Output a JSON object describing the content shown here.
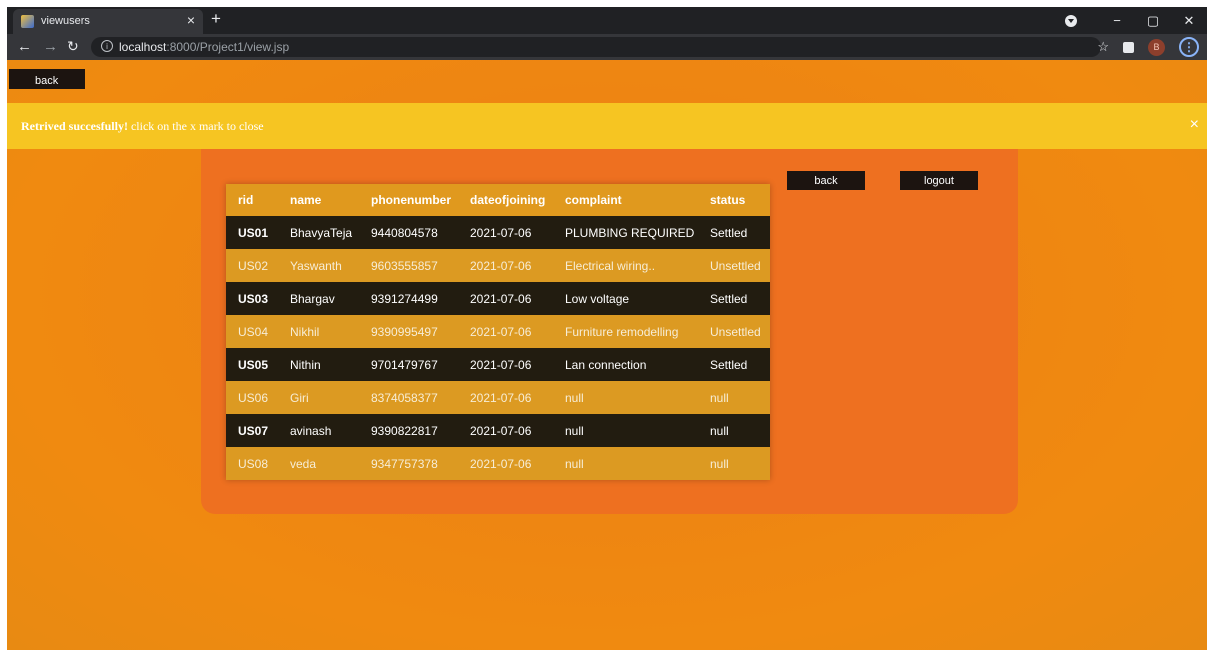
{
  "browser": {
    "tab_title": "viewusers",
    "tab_close": "×",
    "new_tab": "+",
    "url_host": "localhost",
    "url_rest": ":8000/Project1/view.jsp",
    "profile_initial": "B",
    "window_controls": [
      "−",
      "▢",
      "✕"
    ]
  },
  "page": {
    "top_back_label": "back",
    "alert": {
      "strong": "Retrived succesfully!",
      "text": " click on the x mark to close",
      "close": "×"
    },
    "back_label": "back",
    "logout_label": "logout"
  },
  "table": {
    "headers": [
      "rid",
      "name",
      "phonenumber",
      "dateofjoining",
      "complaint",
      "status"
    ],
    "rows": [
      {
        "rid": "US01",
        "name": "BhavyaTeja",
        "phone": "9440804578",
        "date": "2021-07-06",
        "complaint": "PLUMBING REQUIRED",
        "status": "Settled"
      },
      {
        "rid": "US02",
        "name": "Yaswanth",
        "phone": "9603555857",
        "date": "2021-07-06",
        "complaint": "Electrical wiring..",
        "status": "Unsettled"
      },
      {
        "rid": "US03",
        "name": "Bhargav",
        "phone": "9391274499",
        "date": "2021-07-06",
        "complaint": "Low voltage",
        "status": "Settled"
      },
      {
        "rid": "US04",
        "name": "Nikhil",
        "phone": "9390995497",
        "date": "2021-07-06",
        "complaint": "Furniture remodelling",
        "status": "Unsettled"
      },
      {
        "rid": "US05",
        "name": "Nithin",
        "phone": "9701479767",
        "date": "2021-07-06",
        "complaint": "Lan connection",
        "status": "Settled"
      },
      {
        "rid": "US06",
        "name": "Giri",
        "phone": "8374058377",
        "date": "2021-07-06",
        "complaint": "null",
        "status": "null"
      },
      {
        "rid": "US07",
        "name": "avinash",
        "phone": "9390822817",
        "date": "2021-07-06",
        "complaint": "null",
        "status": "null"
      },
      {
        "rid": "US08",
        "name": "veda",
        "phone": "9347757378",
        "date": "2021-07-06",
        "complaint": "null",
        "status": "null"
      }
    ]
  },
  "colors": {
    "alert_bg": "#f6c522",
    "panel_bg": "#ee7020",
    "row_dark": "#221c10",
    "row_light": "#dc9a22",
    "header_bg": "#e0991e"
  }
}
